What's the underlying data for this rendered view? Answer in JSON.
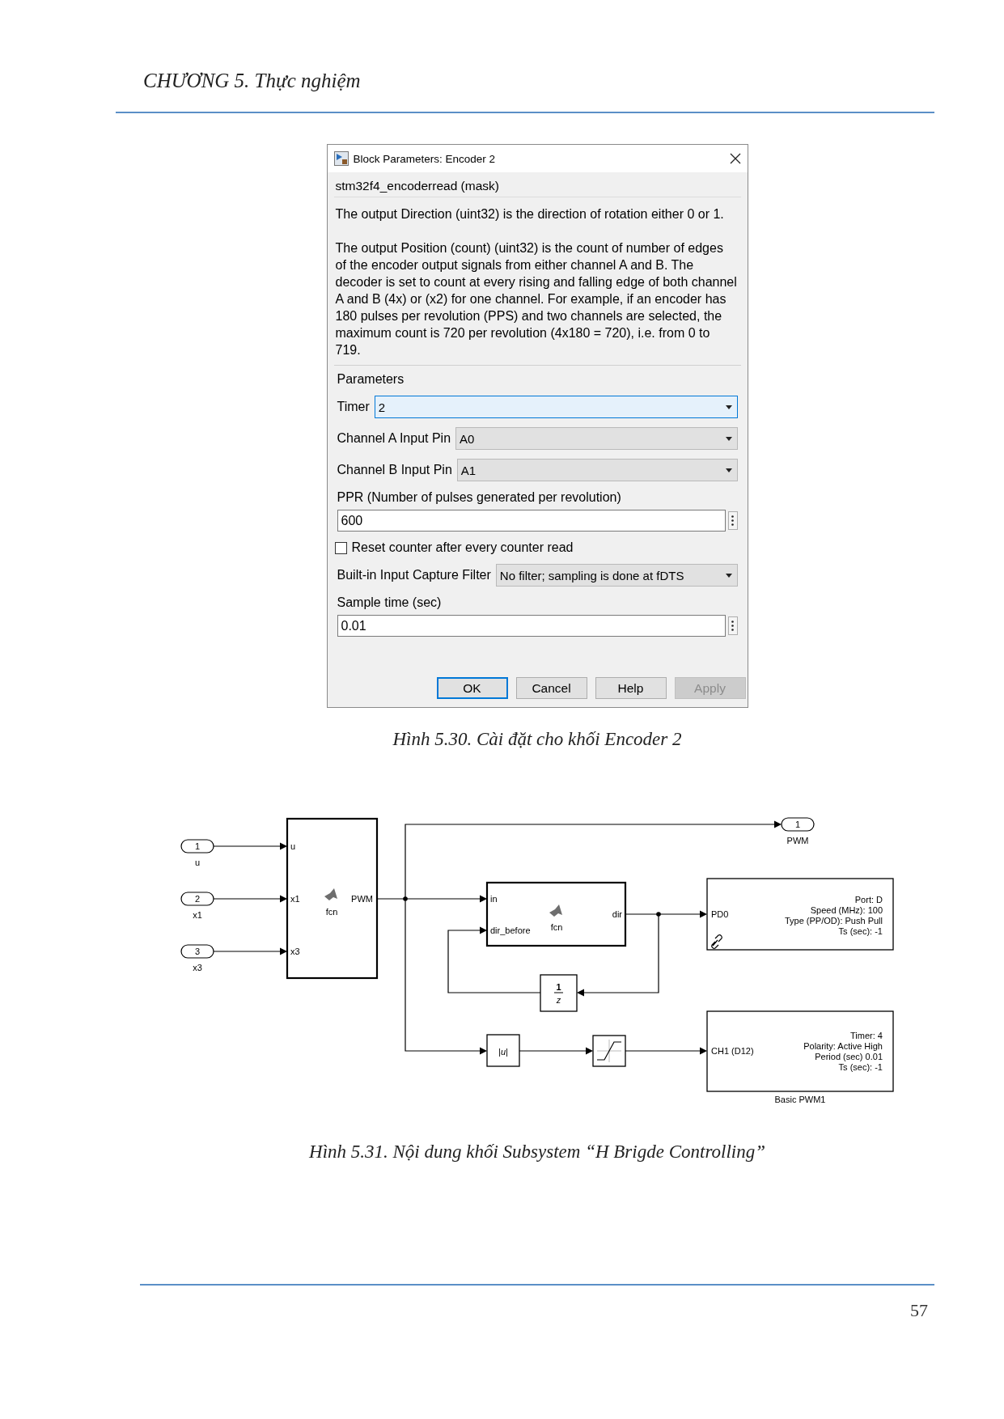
{
  "header": {
    "chapter_title": "CHƯƠNG 5. Thực nghiệm"
  },
  "dialog": {
    "title": "Block Parameters: Encoder 2",
    "mask_title": "stm32f4_encoderread (mask)",
    "description": [
      "The output Direction (uint32) is the direction of rotation either 0 or 1.",
      "The output Position (count) (uint32) is the count of number of edges of the encoder output signals from either channel A and B. The decoder is set to count at every rising and falling edge of both channel A and B (4x) or (x2) for one channel. For example, if an encoder has 180 pulses per revolution (PPS) and two channels are selected, the maximum count is 720 per revolution (4x180 = 720), i.e. from 0 to 719."
    ],
    "parameters_title": "Parameters",
    "fields": [
      {
        "kind": "dropdown",
        "label": "Timer",
        "value": "2",
        "focused": true
      },
      {
        "kind": "dropdown",
        "label": "Channel A Input Pin",
        "value": "A0",
        "focused": false
      },
      {
        "kind": "dropdown",
        "label": "Channel B Input Pin",
        "value": "A1",
        "focused": false
      },
      {
        "kind": "text",
        "label": "PPR (Number of pulses generated per revolution)",
        "value": "600"
      },
      {
        "kind": "checkbox",
        "label": "Reset counter after every counter read",
        "checked": false
      },
      {
        "kind": "dropdown",
        "label": "Built-in Input Capture Filter",
        "value": "No filter; sampling is done at fDTS",
        "focused": false
      },
      {
        "kind": "text",
        "label": "Sample time (sec)",
        "value": "0.01"
      }
    ],
    "buttons": [
      {
        "label": "OK",
        "default": true,
        "disabled": false
      },
      {
        "label": "Cancel",
        "default": false,
        "disabled": false
      },
      {
        "label": "Help",
        "default": false,
        "disabled": false
      },
      {
        "label": "Apply",
        "default": false,
        "disabled": true
      }
    ]
  },
  "figure_caption_1": "Hình 5.30. Cài đặt cho khối Encoder 2",
  "diagram": {
    "inports": [
      {
        "number": "1",
        "name": "u"
      },
      {
        "number": "2",
        "name": "x1"
      },
      {
        "number": "3",
        "name": "x3"
      }
    ],
    "function_block_1": {
      "inputs": [
        "u",
        "x1",
        "x3"
      ],
      "output": "PWM",
      "name": "fcn"
    },
    "function_block_2": {
      "inputs": [
        "in",
        "dir_before"
      ],
      "output": "dir",
      "name": "fcn"
    },
    "unit_delay": {
      "numerator": "1",
      "denominator": "z"
    },
    "abs_block": {
      "label": "|u|"
    },
    "outport": {
      "number": "1",
      "name": "PWM"
    },
    "gpio_block": {
      "input": "PD0",
      "settings": [
        "Port: D",
        "Speed (MHz): 100",
        "Type (PP/OD): Push Pull",
        "Ts (sec): -1"
      ]
    },
    "pwm_block": {
      "input": "CH1 (D12)",
      "settings": [
        "Timer: 4",
        "Polarity: Active High",
        "Period (sec) 0.01",
        "Ts (sec): -1"
      ],
      "name": "Basic PWM1"
    }
  },
  "figure_caption_2": "Hình 5.31. Nội dung khối Subsystem “H Brigde Controlling”",
  "page_number": "57"
}
